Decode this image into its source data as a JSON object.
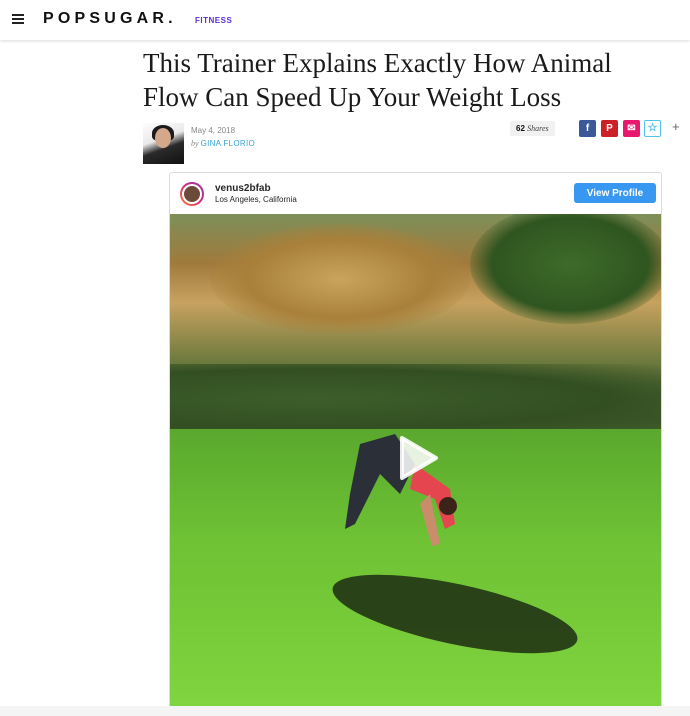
{
  "header": {
    "logo": "POPSUGAR.",
    "section": "FITNESS"
  },
  "article": {
    "title": "This Trainer Explains Exactly How Animal Flow Can Speed Up Your Weight Loss",
    "date": "May 4, 2018",
    "by": "by",
    "author": "GINA FLORIO"
  },
  "share": {
    "count": "62",
    "label": "Shares",
    "facebook_glyph": "f",
    "pinterest_glyph": "P",
    "email_glyph": "✉",
    "favorite_glyph": "☆",
    "more_glyph": "+"
  },
  "instagram": {
    "username": "venus2bfab",
    "location": "Los Angeles, California",
    "view_profile": "View Profile"
  },
  "colors": {
    "brand_section": "#5b2bd6",
    "author_link": "#3aa4d8",
    "facebook": "#3b5998",
    "pinterest": "#cb2027",
    "email": "#e8186f",
    "instagram_button": "#3897f0"
  }
}
